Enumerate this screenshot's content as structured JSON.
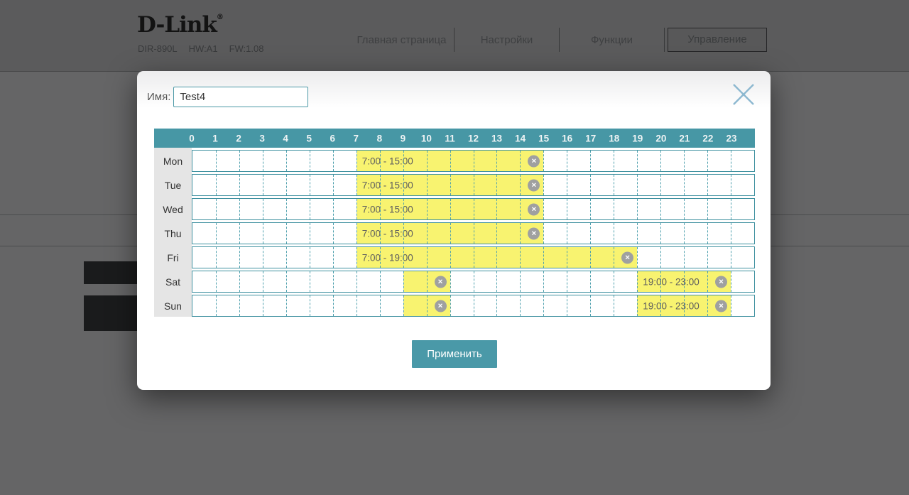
{
  "header": {
    "logo": "D-Link",
    "logo_reg": "®",
    "model": "DIR-890L",
    "hw": "HW:A1",
    "fw": "FW:1.08",
    "nav": [
      {
        "id": "home",
        "label": "Главная страница",
        "active": false
      },
      {
        "id": "settings",
        "label": "Настройки",
        "active": false
      },
      {
        "id": "features",
        "label": "Функции",
        "active": false
      },
      {
        "id": "management",
        "label": "Управление",
        "active": true
      }
    ]
  },
  "modal": {
    "name_label": "Имя:",
    "name_value": "Test4",
    "apply_label": "Применить",
    "schedule": {
      "delete_glyph": "✕",
      "hours": [
        "0",
        "1",
        "2",
        "3",
        "4",
        "5",
        "6",
        "7",
        "8",
        "9",
        "10",
        "11",
        "12",
        "13",
        "14",
        "15",
        "16",
        "17",
        "18",
        "19",
        "20",
        "21",
        "22",
        "23"
      ],
      "days": [
        {
          "label": "Mon",
          "blocks": [
            {
              "start": 7,
              "end": 15,
              "label": "7:00 - 15:00"
            }
          ]
        },
        {
          "label": "Tue",
          "blocks": [
            {
              "start": 7,
              "end": 15,
              "label": "7:00 - 15:00"
            }
          ]
        },
        {
          "label": "Wed",
          "blocks": [
            {
              "start": 7,
              "end": 15,
              "label": "7:00 - 15:00"
            }
          ]
        },
        {
          "label": "Thu",
          "blocks": [
            {
              "start": 7,
              "end": 15,
              "label": "7:00 - 15:00"
            }
          ]
        },
        {
          "label": "Fri",
          "blocks": [
            {
              "start": 7,
              "end": 19,
              "label": "7:00 - 19:00"
            }
          ]
        },
        {
          "label": "Sat",
          "blocks": [
            {
              "start": 9,
              "end": 11,
              "label": ""
            },
            {
              "start": 19,
              "end": 23,
              "label": "19:00 - 23:00"
            }
          ]
        },
        {
          "label": "Sun",
          "blocks": [
            {
              "start": 9,
              "end": 11,
              "label": ""
            },
            {
              "start": 19,
              "end": 23,
              "label": "19:00 - 23:00"
            }
          ]
        }
      ]
    }
  },
  "colors": {
    "accent_teal": "#4797a5",
    "grid_border_teal": "#3f91a0",
    "block_yellow": "#f8f370",
    "delete_icon_gray": "#9fa0a0",
    "close_icon_blue": "#8cb8d0",
    "day_column_gray": "#e5e5e5",
    "overlay": "rgba(0,0,0,0.55)"
  }
}
